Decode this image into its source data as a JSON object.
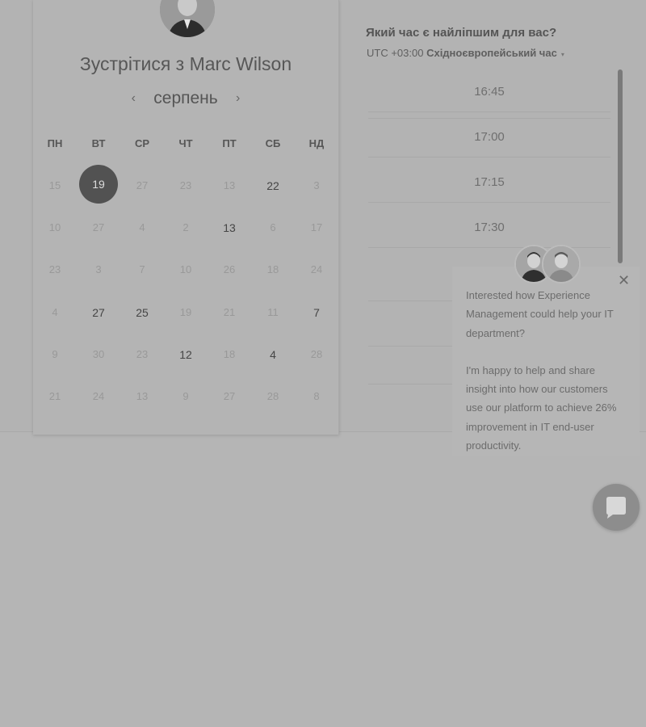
{
  "booking": {
    "title": "Зустрітися з Marc Wilson",
    "month": "серпень",
    "prev_icon": "chevron-left-icon",
    "next_icon": "chevron-right-icon",
    "weekdays": [
      "ПН",
      "ВТ",
      "СР",
      "ЧТ",
      "ПТ",
      "СБ",
      "НД"
    ],
    "weeks": [
      [
        {
          "d": "15",
          "s": "muted"
        },
        {
          "d": "19",
          "s": "selected"
        },
        {
          "d": "27",
          "s": "muted"
        },
        {
          "d": "23",
          "s": "muted"
        },
        {
          "d": "13",
          "s": "muted"
        },
        {
          "d": "22",
          "s": "avail"
        },
        {
          "d": "3",
          "s": "muted"
        }
      ],
      [
        {
          "d": "10",
          "s": "muted"
        },
        {
          "d": "27",
          "s": "muted"
        },
        {
          "d": "4",
          "s": "muted"
        },
        {
          "d": "2",
          "s": "muted"
        },
        {
          "d": "13",
          "s": "avail"
        },
        {
          "d": "6",
          "s": "muted"
        },
        {
          "d": "17",
          "s": "muted"
        }
      ],
      [
        {
          "d": "23",
          "s": "muted"
        },
        {
          "d": "3",
          "s": "muted"
        },
        {
          "d": "7",
          "s": "muted"
        },
        {
          "d": "10",
          "s": "muted"
        },
        {
          "d": "26",
          "s": "muted"
        },
        {
          "d": "18",
          "s": "muted"
        },
        {
          "d": "24",
          "s": "muted"
        }
      ],
      [
        {
          "d": "4",
          "s": "muted"
        },
        {
          "d": "27",
          "s": "avail"
        },
        {
          "d": "25",
          "s": "avail"
        },
        {
          "d": "19",
          "s": "muted"
        },
        {
          "d": "21",
          "s": "muted"
        },
        {
          "d": "11",
          "s": "muted"
        },
        {
          "d": "7",
          "s": "avail"
        }
      ],
      [
        {
          "d": "9",
          "s": "muted"
        },
        {
          "d": "30",
          "s": "muted"
        },
        {
          "d": "23",
          "s": "muted"
        },
        {
          "d": "12",
          "s": "avail"
        },
        {
          "d": "18",
          "s": "muted"
        },
        {
          "d": "4",
          "s": "avail"
        },
        {
          "d": "28",
          "s": "muted"
        }
      ],
      [
        {
          "d": "21",
          "s": "muted"
        },
        {
          "d": "24",
          "s": "muted"
        },
        {
          "d": "13",
          "s": "muted"
        },
        {
          "d": "9",
          "s": "muted"
        },
        {
          "d": "27",
          "s": "muted"
        },
        {
          "d": "28",
          "s": "muted"
        },
        {
          "d": "8",
          "s": "muted"
        }
      ]
    ]
  },
  "time": {
    "question": "Який час є найліпшим для вас?",
    "tz_offset": "UTC +03:00",
    "tz_name": "Східноєвропейський час",
    "tz_caret": "▾",
    "slots": [
      "16:45",
      "17:00",
      "17:15",
      "17:30"
    ]
  },
  "chat": {
    "close_icon": "close-icon",
    "message": [
      "Interested how Experience Management could help your IT department?",
      "I'm happy to help and share insight into how our customers use our platform to achieve 26% improvement in IT end-user productivity."
    ],
    "launcher_icon": "chat-bubble-icon"
  },
  "colors": {
    "overlay": "#b5b5b5",
    "selected_day": "#525252",
    "text": "#555555"
  }
}
